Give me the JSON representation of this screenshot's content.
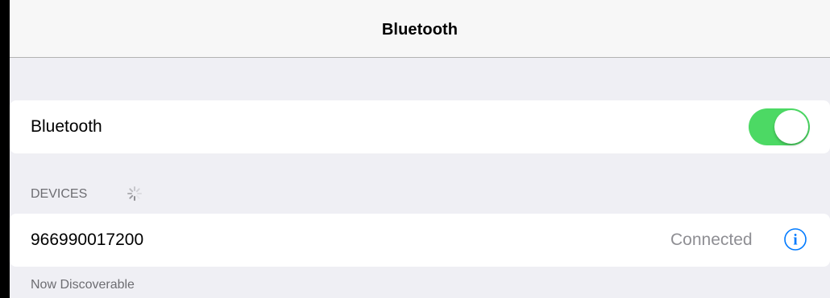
{
  "nav": {
    "title": "Bluetooth"
  },
  "bluetooth_cell": {
    "label": "Bluetooth",
    "toggle_on": true
  },
  "devices_section": {
    "header": "DEVICES",
    "searching_icon": "activity-spinner-icon"
  },
  "device": {
    "name": "966990017200",
    "status": "Connected",
    "info_icon": "info-icon"
  },
  "footer": {
    "text": "Now Discoverable"
  },
  "colors": {
    "toggle_on": "#4cd964",
    "accent": "#007aff",
    "background": "#efeff4",
    "secondary_text": "#8e8e93",
    "section_text": "#6d6d72"
  }
}
